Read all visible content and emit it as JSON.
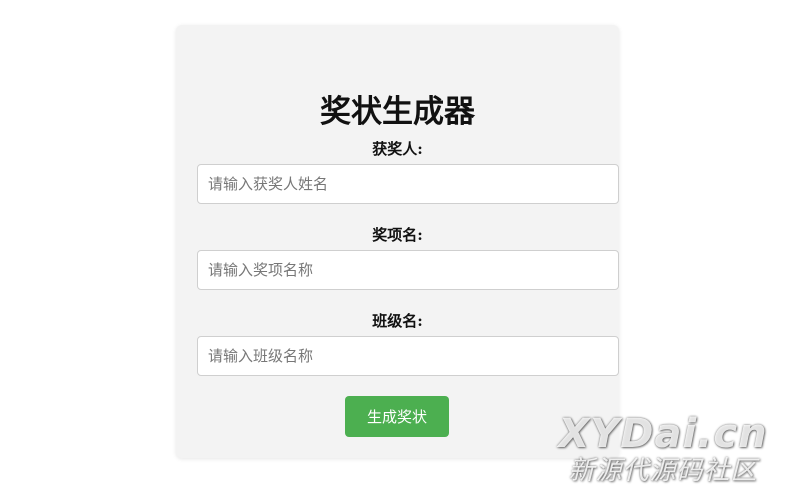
{
  "form": {
    "title": "奖状生成器",
    "fields": [
      {
        "label": "获奖人:",
        "placeholder": "请输入获奖人姓名",
        "value": ""
      },
      {
        "label": "奖项名:",
        "placeholder": "请输入奖项名称",
        "value": ""
      },
      {
        "label": "班级名:",
        "placeholder": "请输入班级名称",
        "value": ""
      }
    ],
    "submit_label": "生成奖状"
  },
  "watermark": {
    "main": "XYDai.cn",
    "sub": "新源代源码社区"
  },
  "colors": {
    "card_background": "#f3f3f3",
    "button_background": "#4caf50",
    "button_text": "#ffffff"
  }
}
